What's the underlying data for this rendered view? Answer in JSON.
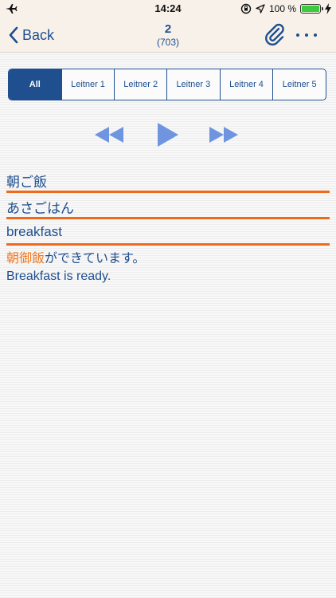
{
  "status_bar": {
    "time": "14:24",
    "battery": "100 %",
    "battery_level": 1.0,
    "icons": [
      "airplane-mode-icon",
      "orientation-lock-icon",
      "location-icon",
      "battery-icon",
      "charging-icon"
    ]
  },
  "nav": {
    "back_label": "Back",
    "card_number": "2",
    "card_total": "(703)",
    "icons": [
      "back-chevron-icon",
      "paperclip-icon",
      "more-icon"
    ]
  },
  "filter": {
    "segments": [
      "All",
      "Leitner 1",
      "Leitner 2",
      "Leitner 3",
      "Leitner 4",
      "Leitner 5"
    ],
    "selected": "All"
  },
  "controls": {
    "icons": [
      "rewind-icon",
      "play-icon",
      "fast-forward-icon"
    ]
  },
  "card": {
    "kanji": "朝ご飯",
    "reading": "あさごはん",
    "meaning": "breakfast",
    "example_highlight": "朝御飯",
    "example_rest": "ができています。",
    "example_translation": "Breakfast is ready."
  },
  "colors": {
    "accent_blue": "#1f4f8f",
    "icon_blue": "#6f95e0",
    "rule_orange": "#f06a1e",
    "highlight_orange": "#f07820",
    "bar_bg": "#f7f1e9"
  }
}
